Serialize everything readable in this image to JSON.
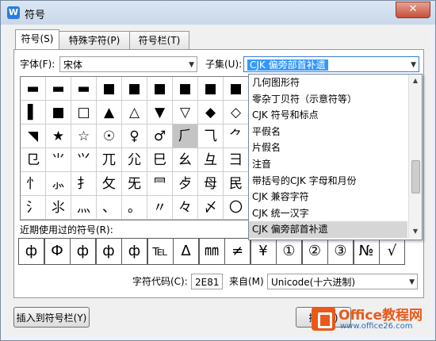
{
  "window": {
    "title": "符号",
    "close": "✕",
    "app_icon": "W"
  },
  "tabs": [
    "符号(S)",
    "特殊字符(P)",
    "符号栏(T)"
  ],
  "font": {
    "label": "字体(F):",
    "value": "宋体"
  },
  "subset": {
    "label": "子集(U):",
    "value": "CJK 偏旁部首补遗"
  },
  "subset_options": [
    "几何图形符",
    "零杂丁贝符（示意符等）",
    "CJK 符号和标点",
    "平假名",
    "片假名",
    "注音",
    "带括号的CJK 字母和月份",
    "CJK 兼容字符",
    "CJK 统一汉字",
    "CJK 偏旁部首补遗"
  ],
  "symbol_grid": [
    [
      "▬",
      "▬",
      "▬",
      "■",
      "■",
      "■",
      "■",
      "■",
      "■"
    ],
    [
      "▌",
      "■",
      "□",
      "▲",
      "△",
      "▼",
      "▽",
      "◆",
      "◇"
    ],
    [
      "◥",
      "★",
      "☆",
      "☉",
      "♀",
      "♂",
      "⺁",
      "⺄",
      "⺈"
    ],
    [
      "⺋",
      "⺌",
      "⺍",
      "⺎",
      "⺏",
      "⺒",
      "⺓",
      "⺔",
      "⺕"
    ],
    [
      "⺖",
      "⺗",
      "⺘",
      "⺙",
      "⺛",
      "⺜",
      "⺞",
      "⺟",
      "⺠"
    ],
    [
      "⺡",
      "⺢",
      "⺣",
      "、",
      "。",
      "〃",
      "々",
      "〆",
      "〇"
    ]
  ],
  "selected_cell": "⺁",
  "recent": {
    "label": "近期使用过的符号(R):",
    "symbols": [
      "ф",
      "Ф",
      "ф",
      "ф",
      "ф",
      "℡",
      "Δ",
      "㎜",
      "≠",
      "¥",
      "①",
      "②",
      "③",
      "№",
      "√"
    ]
  },
  "charcode": {
    "label": "字符代码(C):",
    "value": "2E81",
    "from_label": "来自(M)",
    "from_value": "Unicode(十六进制)"
  },
  "buttons": {
    "insert_to_bar": "插入到符号栏(Y)",
    "insert": "插入(I)"
  },
  "watermark": {
    "title": "Office教程网",
    "url": "www.office26.com"
  }
}
